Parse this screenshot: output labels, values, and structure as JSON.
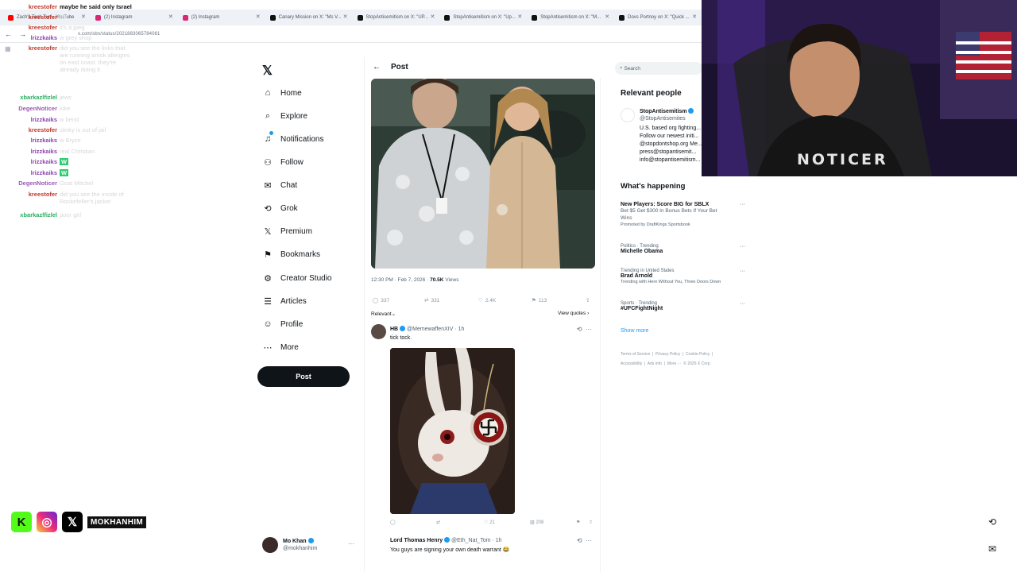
{
  "browser": {
    "tabs": [
      {
        "label": "Zach's Tech Turf - YouTube",
        "color": "#ff0000"
      },
      {
        "label": "(2) Instagram",
        "color": "#d62976"
      },
      {
        "label": "(2) Instagram",
        "color": "#d62976"
      },
      {
        "label": "Canary Mission on X: \"Ms V...",
        "color": "#111111"
      },
      {
        "label": "StopAntisemitism on X: \"UP...",
        "color": "#111111"
      },
      {
        "label": "StopAntisemitism on X: \"Up...",
        "color": "#111111"
      },
      {
        "label": "StopAntisemitism on X: \"M...",
        "color": "#111111"
      },
      {
        "label": "Dovs Portnoy on X: \"Quick ...",
        "color": "#111111"
      }
    ],
    "url": "x.com/sbn/status/2021883065784061"
  },
  "chat": [
    {
      "user": "kreestofer",
      "msg": "maybe he said only Israel",
      "color": "#c0392b",
      "top": true
    },
    {
      "user": "kreestofer",
      "msg": "lol",
      "color": "#c0392b"
    },
    {
      "user": "kreestofer",
      "msg": "it's a jpeg",
      "color": "#c0392b"
    },
    {
      "user": "lrizzkaiks",
      "msg": "w grey shop",
      "color": "#8e44ad"
    },
    {
      "user": "kreestofer",
      "msg": "did you see the links that\nare running amok allergies\non east coast. they're\nalready doing it.",
      "color": "#c0392b"
    },
    {
      "user": "xbarkazlfizlel",
      "msg": "jews",
      "color": "#27ae60"
    },
    {
      "user": "DegenNoticer",
      "msg": "kike",
      "color": "#9b59b6"
    },
    {
      "user": "lrizzkaiks",
      "msg": "w bend",
      "color": "#8e44ad"
    },
    {
      "user": "kreestofer",
      "msg": "slinky is out of jail",
      "color": "#c0392b"
    },
    {
      "user": "lrizzkaiks",
      "msg": "w Bryce",
      "color": "#8e44ad"
    },
    {
      "user": "lrizzkaiks",
      "msg": "real Christian",
      "color": "#8e44ad"
    },
    {
      "user": "lrizzkaiks",
      "msg": "W",
      "color": "#8e44ad",
      "badge": true
    },
    {
      "user": "lrizzkaiks",
      "msg": "W",
      "color": "#8e44ad",
      "badge": true
    },
    {
      "user": "DegenNoticer",
      "msg": "Goat Mitchel",
      "color": "#9b59b6"
    },
    {
      "user": "kreestofer",
      "msg": "did you see the inside of\nRockefeller's jacket",
      "color": "#c0392b"
    },
    {
      "user": "xbarkazlfizlel",
      "msg": "poor girl",
      "color": "#27ae60"
    }
  ],
  "nav": {
    "items": [
      {
        "label": "Home",
        "icon": "home-icon"
      },
      {
        "label": "Explore",
        "icon": "search-icon"
      },
      {
        "label": "Notifications",
        "icon": "bell-icon"
      },
      {
        "label": "Follow",
        "icon": "person-add-icon"
      },
      {
        "label": "Chat",
        "icon": "mail-icon"
      },
      {
        "label": "Grok",
        "icon": "grok-icon"
      },
      {
        "label": "Premium",
        "icon": "x-premium-icon"
      },
      {
        "label": "Bookmarks",
        "icon": "bookmark-icon"
      },
      {
        "label": "Creator Studio",
        "icon": "studio-icon"
      },
      {
        "label": "Articles",
        "icon": "articles-icon"
      },
      {
        "label": "Profile",
        "icon": "profile-icon"
      },
      {
        "label": "More",
        "icon": "more-icon"
      }
    ],
    "post_button": "Post",
    "account_name": "Mo Khan",
    "account_handle": "@mokhanhim"
  },
  "main": {
    "header_title": "Post",
    "meta_time": "12:30 PM · Feb 7, 2026 · ",
    "meta_views": "70.5K",
    "meta_views_label": " Views",
    "replies": "337",
    "reposts": "331",
    "likes": "2.4K",
    "bookmarks": "113",
    "sort_label": "Relevant",
    "view_quotes": "View quotes",
    "reply1": {
      "name": "HB",
      "handle": "@MemewaffenXIV · 1h",
      "text": "tick tock.",
      "likes": "21",
      "views": "208"
    },
    "reply2": {
      "name": "Lord Thomas Henry",
      "handle": "@Eth_Nat_Tom · 1h",
      "text": "You guys are signing your own death warrant 😂"
    }
  },
  "right": {
    "search_placeholder": "Search",
    "relevant_title": "Relevant people",
    "rel_name": "StopAntisemitism",
    "rel_handle": "@StopAntisemites",
    "rel_bio": "U.S. based org fighting...\nFollow our newest initi...\n@stopdontshop.org Me...\npress@stopantisemit...\ninfo@stopantisemitism...",
    "happening_title": "What's happening",
    "trends": [
      {
        "ctx": "",
        "name": "New Players: Score BIG for SBLX",
        "sub": "Bet $5 Get $300 In Bonus Bets If Your Bet\nWins",
        "extra": "Promoted by DraftKings Sportsbook"
      },
      {
        "ctx": "Politics · Trending",
        "name": "Michelle Obama",
        "sub": "",
        "extra": ""
      },
      {
        "ctx": "Trending in United States",
        "name": "Brad Arnold",
        "sub": "",
        "extra": "Trending with Here Without You, Three Doors Down"
      },
      {
        "ctx": "Sports · Trending",
        "name": "#UFCFightNight",
        "sub": "",
        "extra": ""
      }
    ],
    "show_more": "Show more",
    "footer": "Terms of Service  |  Privacy Policy  |  Cookie Policy  |\nAccessibility  |  Ads info  |  More ···  © 2026 X Corp."
  },
  "stream": {
    "handle": "MOKHANHIM",
    "shirt_text": "NOTICER",
    "colors": {
      "kick": "#53fc18",
      "x": "#000000"
    }
  }
}
